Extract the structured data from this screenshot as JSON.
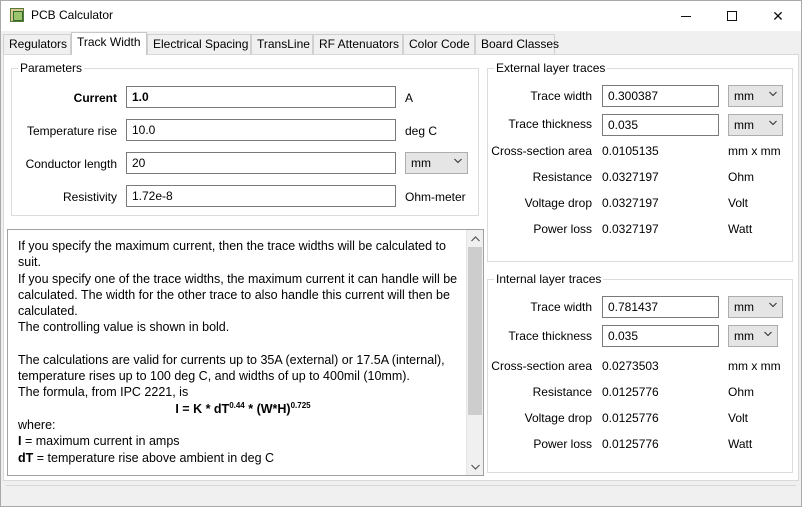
{
  "window": {
    "title": "PCB Calculator",
    "icon": "pcb-calculator-app-icon",
    "controls": {
      "minimize": "minimize-icon",
      "maximize": "maximize-icon",
      "close": "close-icon",
      "close_glyph": "✕"
    }
  },
  "tabs": [
    {
      "label": "Regulators",
      "active": false
    },
    {
      "label": "Track Width",
      "active": true
    },
    {
      "label": "Electrical Spacing",
      "active": false
    },
    {
      "label": "TransLine",
      "active": false
    },
    {
      "label": "RF Attenuators",
      "active": false
    },
    {
      "label": "Color Code",
      "active": false
    },
    {
      "label": "Board Classes",
      "active": false
    }
  ],
  "parameters": {
    "title": "Parameters",
    "current": {
      "label": "Current",
      "value": "1.0",
      "unit": "A"
    },
    "temperature_rise": {
      "label": "Temperature rise",
      "value": "10.0",
      "unit": "deg C"
    },
    "conductor_length": {
      "label": "Conductor length",
      "value": "20",
      "unit": "mm"
    },
    "resistivity": {
      "label": "Resistivity",
      "value": "1.72e-8",
      "unit": "Ohm-meter"
    }
  },
  "help_text": {
    "p1": "If you specify the maximum current, then the trace widths will be calculated to suit.",
    "p2": "If you specify one of the trace widths, the maximum current it can handle will be calculated. The width for the other trace to also handle this current will then be calculated.",
    "p3": "The controlling value is shown in bold.",
    "p4": "The calculations are valid for currents up to 35A (external) or 17.5A (internal), temperature rises up to 100 deg C, and widths of up to 400mil (10mm).",
    "p5": "The formula, from IPC 2221, is",
    "formula_a": "I = K * dT",
    "formula_exp1": "0.44",
    "formula_b": " * (W*H)",
    "formula_exp2": "0.725",
    "where": "where:",
    "i_sym": "I",
    "i_desc": " = maximum current in amps",
    "dt_sym": "dT",
    "dt_desc": " = temperature rise above ambient in deg C"
  },
  "external": {
    "title": "External layer traces",
    "trace_width": {
      "label": "Trace width",
      "value": "0.300387",
      "unit": "mm"
    },
    "trace_thickness": {
      "label": "Trace thickness",
      "value": "0.035",
      "unit": "mm"
    },
    "cross_section": {
      "label": "Cross-section area",
      "value": "0.0105135",
      "unit": "mm x mm"
    },
    "resistance": {
      "label": "Resistance",
      "value": "0.0327197",
      "unit": "Ohm"
    },
    "voltage_drop": {
      "label": "Voltage drop",
      "value": "0.0327197",
      "unit": "Volt"
    },
    "power_loss": {
      "label": "Power loss",
      "value": "0.0327197",
      "unit": "Watt"
    }
  },
  "internal": {
    "title": "Internal layer traces",
    "trace_width": {
      "label": "Trace width",
      "value": "0.781437",
      "unit": "mm"
    },
    "trace_thickness": {
      "label": "Trace thickness",
      "value": "0.035",
      "unit": "mm"
    },
    "cross_section": {
      "label": "Cross-section area",
      "value": "0.0273503",
      "unit": "mm x mm"
    },
    "resistance": {
      "label": "Resistance",
      "value": "0.0125776",
      "unit": "Ohm"
    },
    "voltage_drop": {
      "label": "Voltage drop",
      "value": "0.0125776",
      "unit": "Volt"
    },
    "power_loss": {
      "label": "Power loss",
      "value": "0.0125776",
      "unit": "Watt"
    }
  }
}
